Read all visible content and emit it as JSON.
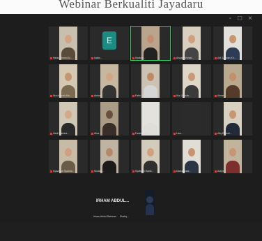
{
  "page_top_text": "Webinar Berkualiti Jayadaru",
  "window_controls": [
    "-",
    "□",
    "×"
  ],
  "participants": [
    {
      "name": "Hanis Ahmed Al...",
      "bg": "#c9bfae",
      "skin": "#d3a484",
      "shirt": "#5a4a3a"
    },
    {
      "name": "Isabe...",
      "avatar_letter": "E",
      "avatar_color": "#1c8c82"
    },
    {
      "name": "Syabira...",
      "bg": "#b9a58d",
      "skin": "#c48e6e",
      "shirt": "#222222",
      "active": true
    },
    {
      "name": "Aisyah Ahmad...",
      "bg": "#d8cfbf",
      "skin": "#cf9f7e",
      "shirt": "#444444"
    },
    {
      "name": "Arif Zakwan Kh...",
      "bg": "#e2e0da",
      "skin": "#c9976f",
      "shirt": "#2e3b55"
    },
    {
      "name": "Nurul Izzah Ma...",
      "bg": "#d4c8b2",
      "skin": "#c69671",
      "shirt": "#7a6a50"
    },
    {
      "name": "Amira...",
      "bg": "#c6b8a0",
      "skin": "#d2a585",
      "shirt": "#333333"
    },
    {
      "name": "Fatin Syahirah...",
      "bg": "#cbc2b3",
      "skin": "#c08a66",
      "shirt": "#d6d6d6"
    },
    {
      "name": "Nur Jannah...",
      "bg": "#ded7c8",
      "skin": "#c99a77",
      "shirt": "#3a3a3a"
    },
    {
      "name": "Aiman...",
      "bg": "#b8a98f",
      "skin": "#c48f6b",
      "shirt": "#553c2a"
    },
    {
      "name": "Hani Sabrina...",
      "bg": "#cfc6b6",
      "skin": "#d4a889",
      "shirt": "#2a2a2a"
    },
    {
      "name": "Aina...",
      "bg": "#aa9b85",
      "skin": "#6b4f3e",
      "shirt": "#3a2f28"
    },
    {
      "name": "Farah Nadia...",
      "bg": "#e4e2dc",
      "skin": "#e4e2dc",
      "shirt": "#e0ded8"
    },
    {
      "name": "Lisa...",
      "bg": "#2b2b2b",
      "skin": "#2b2b2b",
      "shirt": "#2b2b2b"
    },
    {
      "name": "Afiq Danish...",
      "bg": "#d8d1c2",
      "skin": "#c99672",
      "shirt": "#222a3a"
    },
    {
      "name": "Syazwani Syahira...",
      "bg": "#c7bba6",
      "skin": "#cf9f80",
      "shirt": "#6a5a48"
    },
    {
      "name": "Noraini...",
      "bg": "#bfb4a1",
      "skin": "#b7876a",
      "shirt": "#1b1b1b"
    },
    {
      "name": "Syafiqah Hanis...",
      "bg": "#d3cbbb",
      "skin": "#d3a07f",
      "shirt": "#2f2f2f"
    },
    {
      "name": "Danial Izzat...",
      "bg": "#e0ddd5",
      "skin": "#c9946f",
      "shirt": "#2b3445"
    },
    {
      "name": "Auliya...",
      "bg": "#c2b49c",
      "skin": "#c99574",
      "shirt": "#7d2e2e"
    }
  ],
  "speaker": {
    "name": "IRHAM ABDUL...",
    "captions": [
      "Irham Abdul Rahman",
      "Shafiq..."
    ]
  }
}
